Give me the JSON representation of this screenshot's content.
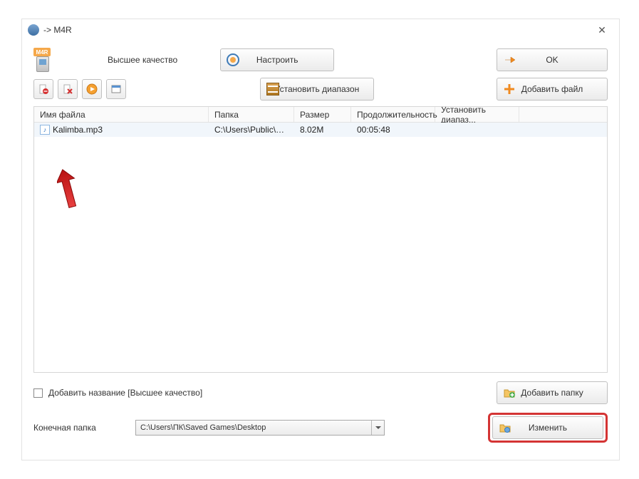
{
  "titlebar": {
    "title": " -> M4R"
  },
  "m4r_tag": "M4R",
  "quality_label": "Высшее качество",
  "buttons": {
    "configure": "Настроить",
    "ok": "OK",
    "set_range": "Установить диапазон",
    "add_file": "Добавить файл",
    "add_folder": "Добавить папку",
    "change": "Изменить"
  },
  "table": {
    "headers": {
      "name": "Имя файла",
      "folder": "Папка",
      "size": "Размер",
      "duration": "Продолжительность",
      "range": "Установить диапаз..."
    },
    "rows": [
      {
        "name": "Kalimba.mp3",
        "folder": "C:\\Users\\Public\\Mu...",
        "size": "8.02M",
        "duration": "00:05:48",
        "range": ""
      }
    ]
  },
  "footer": {
    "add_title_label": "Добавить название [Высшее качество]",
    "output_folder_label": "Конечная папка",
    "output_folder_value": "C:\\Users\\ПК\\Saved Games\\Desktop"
  }
}
